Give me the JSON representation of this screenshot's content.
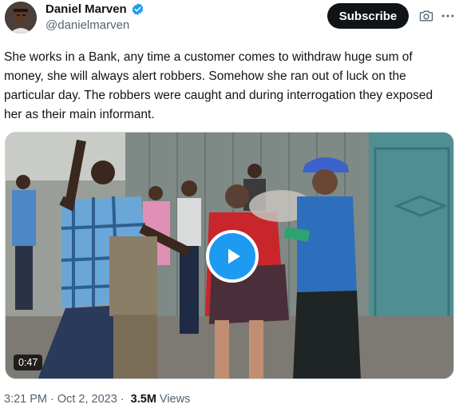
{
  "author": {
    "name": "Daniel Marven",
    "handle": "@danielmarven",
    "verified": true,
    "avatar_icon": "profile-photo"
  },
  "header": {
    "subscribe_label": "Subscribe",
    "camera_icon": "camera-icon",
    "more_icon": "more-icon"
  },
  "tweet": {
    "text": "She works in a Bank, any time a customer comes to withdraw huge sum of money, she will always alert robbers. Somehow she ran out of luck on the particular day. The robbers were caught and during interrogation they exposed her as their main informant."
  },
  "media": {
    "duration": "0:47",
    "play_icon": "play-icon"
  },
  "meta": {
    "time": "3:21 PM",
    "separator": "·",
    "date": "Oct 2, 2023",
    "views_count": "3.5M",
    "views_label": "Views"
  },
  "colors": {
    "accent": "#1d9bf0",
    "text": "#0f1419",
    "muted": "#536471"
  }
}
